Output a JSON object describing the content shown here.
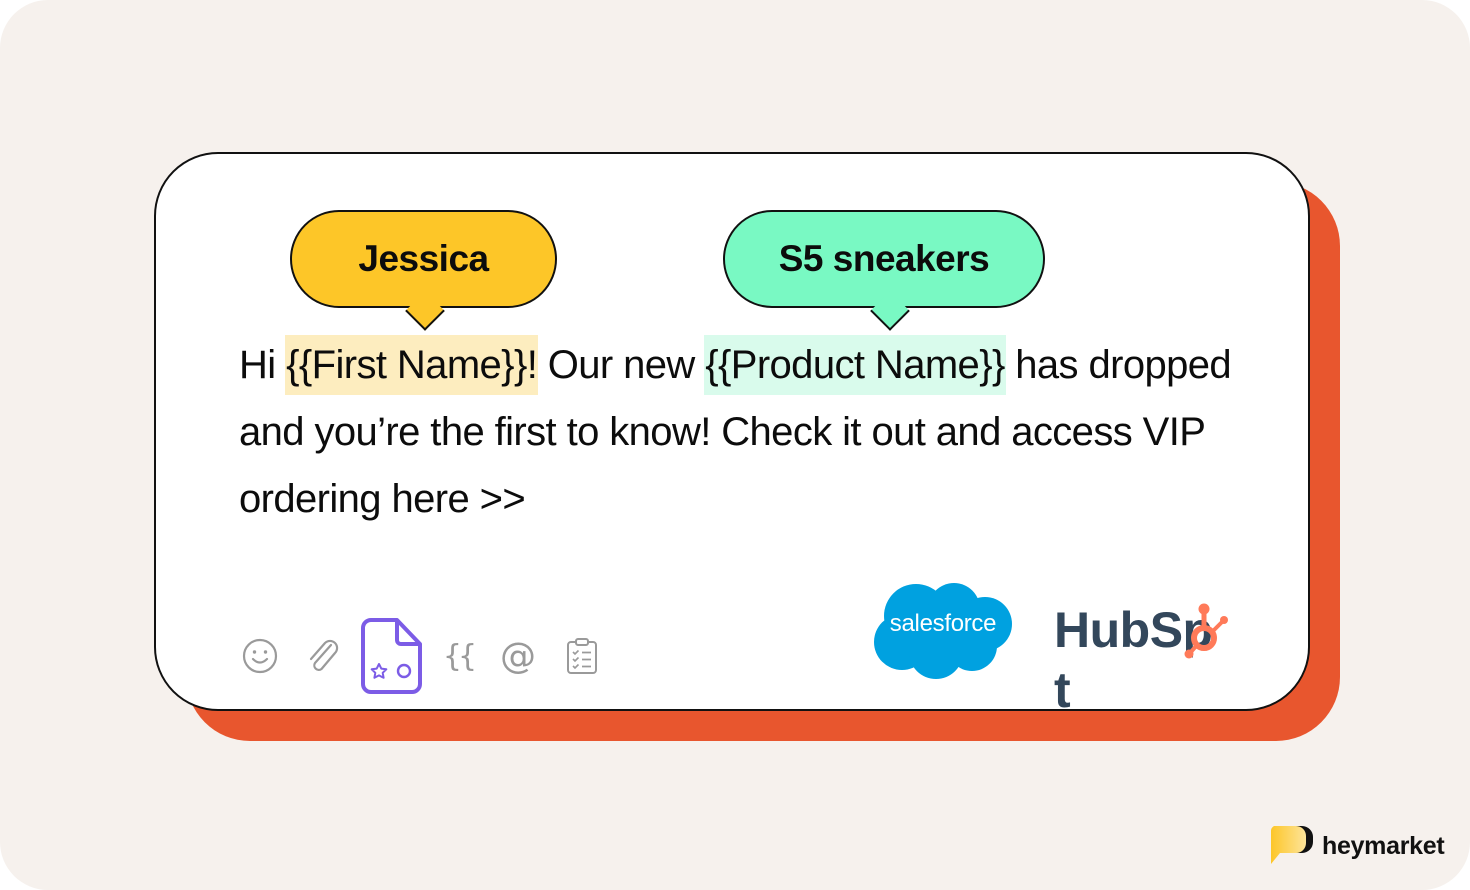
{
  "bubbles": {
    "first_name_value": "Jessica",
    "product_name_value": "S5 sneakers"
  },
  "message": {
    "part1": "Hi ",
    "token_first_name": "{{First Name}}!",
    "part2": " Our new ",
    "token_product_name": "{{Product Name}}",
    "part3": " has dropped and you’re the first to know! Check it out and access VIP ordering here >>"
  },
  "toolbar": {
    "icons": [
      "emoji-icon",
      "attachment-icon",
      "template-file-icon",
      "merge-field-icon",
      "mention-icon",
      "checklist-icon"
    ],
    "merge_field_label": "{{",
    "mention_label": "@",
    "active_icon": "template-file-icon"
  },
  "integrations": {
    "salesforce_label": "salesforce",
    "hubspot_label": "HubSp",
    "hubspot_label_end": "t"
  },
  "brand": {
    "name": "heymarket"
  },
  "colors": {
    "background": "#f6f1ed",
    "card_shadow": "#e8562e",
    "bubble_yellow": "#fdc628",
    "bubble_green": "#79f9c3",
    "highlight_yellow": "#fdedbf",
    "highlight_green": "#d9fbec",
    "active_icon": "#7c5ce6",
    "salesforce_blue": "#00a1e0",
    "hubspot_navy": "#33475b",
    "hubspot_orange": "#ff7a59"
  }
}
